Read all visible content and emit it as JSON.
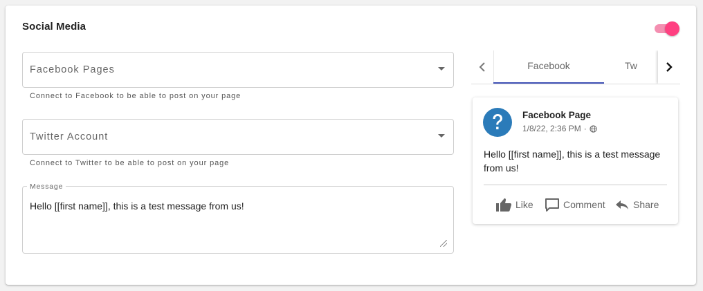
{
  "section": {
    "title": "Social Media",
    "enabled": true
  },
  "fields": {
    "facebook_pages": {
      "label": "Facebook Pages",
      "hint": "Connect to Facebook to be able to post on your page"
    },
    "twitter_account": {
      "label": "Twitter Account",
      "hint": "Connect to Twitter to be able to post on your page"
    },
    "message": {
      "label": "Message",
      "value": "Hello [[first name]], this is a test message from us!"
    }
  },
  "tabs": [
    {
      "label": "Facebook",
      "active": true
    },
    {
      "label": "Tw",
      "active": false
    }
  ],
  "preview": {
    "page_name": "Facebook Page",
    "timestamp": "1/8/22, 2:36 PM",
    "separator": "·",
    "text": "Hello [[first name]], this is a test message from us!",
    "actions": {
      "like": "Like",
      "comment": "Comment",
      "share": "Share"
    }
  },
  "colors": {
    "accent": "#ff4081",
    "tab_indicator": "#3f51b5",
    "avatar": "#2b7bb9"
  },
  "icons": [
    "chevron-left-icon",
    "chevron-right-icon",
    "dropdown-arrow-icon",
    "help-circle-icon",
    "globe-icon",
    "thumb-up-icon",
    "comment-icon",
    "share-icon"
  ]
}
